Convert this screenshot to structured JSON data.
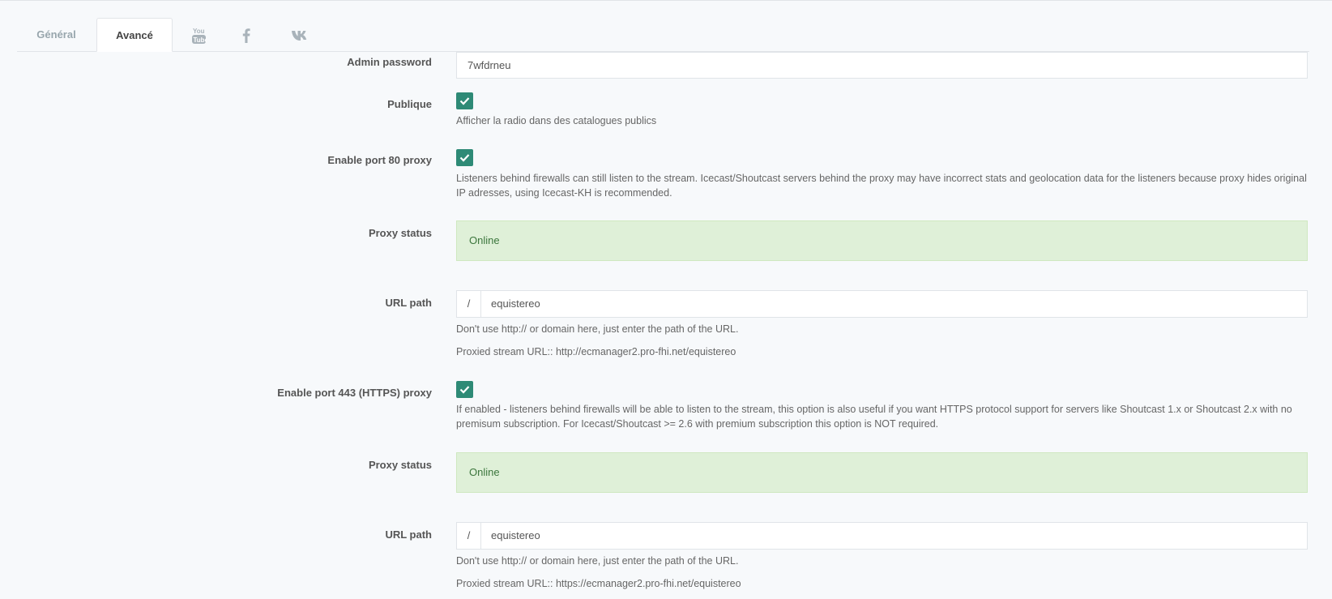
{
  "tabs": [
    {
      "label": "Général"
    },
    {
      "label": "Avancé"
    },
    {
      "icon": "youtube-icon"
    },
    {
      "icon": "facebook-icon"
    },
    {
      "icon": "vk-icon"
    }
  ],
  "admin_password": {
    "label": "Admin password",
    "value": "7wfdrneu"
  },
  "publique": {
    "label": "Publique",
    "checked": true,
    "help": "Afficher la radio dans des catalogues publics"
  },
  "port80": {
    "label": "Enable port 80 proxy",
    "checked": true,
    "help": "Listeners behind firewalls can still listen to the stream. Icecast/Shoutcast servers behind the proxy may have incorrect stats and geolocation data for the listeners because proxy hides original IP adresses, using Icecast-KH is recommended.",
    "status_label": "Proxy status",
    "status": "Online",
    "url_label": "URL path",
    "url_prefix": "/",
    "url_value": "equistereo",
    "url_help": "Don't use http:// or domain here, just enter the path of the URL.",
    "proxied_url": "Proxied stream URL:: http://ecmanager2.pro-fhi.net/equistereo"
  },
  "port443": {
    "label": "Enable port 443 (HTTPS) proxy",
    "checked": true,
    "help": "If enabled - listeners behind firewalls will be able to listen to the stream, this option is also useful if you want HTTPS protocol support for servers like Shoutcast 1.x or Shoutcast 2.x with no premisum subscription. For Icecast/Shoutcast >= 2.6 with premium subscription this option is NOT required.",
    "status_label": "Proxy status",
    "status": "Online",
    "url_label": "URL path",
    "url_prefix": "/",
    "url_value": "equistereo",
    "url_help": "Don't use http:// or domain here, just enter the path of the URL.",
    "proxied_url": "Proxied stream URL:: https://ecmanager2.pro-fhi.net/equistereo"
  },
  "colors": {
    "checkbox": "#2e8a76",
    "success_bg": "#dff0d8",
    "success_text": "#3c763d"
  }
}
